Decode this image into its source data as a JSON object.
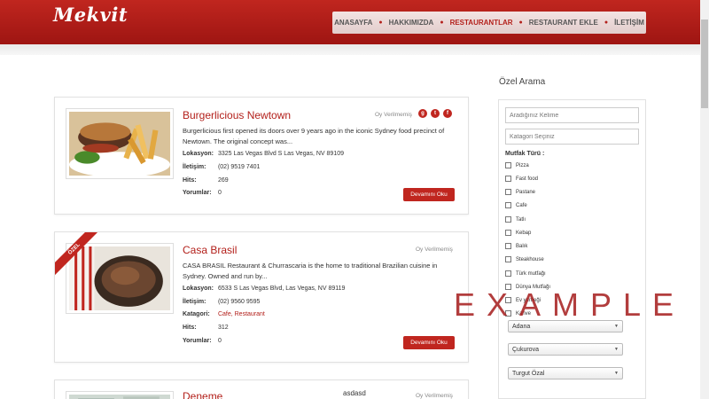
{
  "brand": "Mekvit",
  "nav": [
    {
      "label": "ANASAYFA",
      "active": false
    },
    {
      "label": "HAKKIMIZDA",
      "active": false
    },
    {
      "label": "RESTAURANTLAR",
      "active": true
    },
    {
      "label": "RESTAURANT EKLE",
      "active": false
    },
    {
      "label": "İLETİŞİM",
      "active": false
    }
  ],
  "cards": [
    {
      "title": "Burgerlicious Newtown",
      "rating": "Oy Verilmemiş",
      "desc": "Burgerlicious first opened its doors over 9 years ago in the iconic Sydney food precinct of Newtown. The original concept was...",
      "fields": [
        {
          "label": "Lokasyon:",
          "value": "3325 Las Vegas Blvd S Las Vegas, NV 89109"
        },
        {
          "label": "İletişim:",
          "value": "(02) 9519 7401"
        },
        {
          "label": "Hits:",
          "value": "269"
        },
        {
          "label": "Yorumlar:",
          "value": "0"
        }
      ],
      "button": "Devamını Oku"
    },
    {
      "title": "Casa Brasil",
      "rating": "Oy Verilmemiş",
      "ribbon": "ÖZEL",
      "desc": " CASA BRASIL Restaurant & Churrascaria is the home to traditional Brazilian cuisine in Sydney. Owned and run by...",
      "fields": [
        {
          "label": "Lokasyon:",
          "value": "6533 S Las Vegas Blvd, Las Vegas, NV 89119"
        },
        {
          "label": "İletişim:",
          "value": "(02) 9560 9595"
        },
        {
          "label": "Katagori:",
          "value": "Cafe, Restaurant"
        },
        {
          "label": "Hits:",
          "value": "312"
        },
        {
          "label": "Yorumlar:",
          "value": "0"
        }
      ],
      "button": "Devamını Oku"
    },
    {
      "title": "Deneme",
      "rating": "Oy Verilmemiş",
      "extra": "asdasd"
    }
  ],
  "sidebar": {
    "title": "Özel Arama",
    "keyword_placeholder": "Aradığınız Kelime",
    "category_placeholder": "Katagori Seçiniz",
    "cuisine_label": "Mutfak Türü :",
    "cuisines": [
      "Pizza",
      "Fast food",
      "Pastane",
      "Cafe",
      "Tatlı",
      "Kebap",
      "Balık",
      "Steakhouse",
      "Türk mutfağı",
      "Dünya Mutfağı",
      "Ev yemeği",
      "Kahve"
    ],
    "selects": [
      "Adana",
      "Çukurova",
      "Turgut Özal"
    ]
  },
  "watermark": "EXAMPLE",
  "colors": {
    "brand": "#b3201b",
    "header": "#c0261f"
  }
}
